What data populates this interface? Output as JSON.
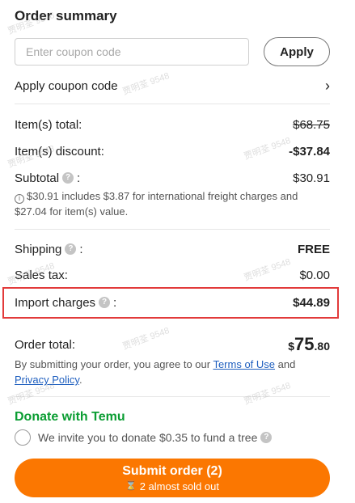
{
  "title": "Order summary",
  "coupon": {
    "placeholder": "Enter coupon code",
    "value": "",
    "apply_label": "Apply",
    "row_label": "Apply coupon code"
  },
  "summary": {
    "items_total_label": "Item(s) total:",
    "items_total_value": "$68.75",
    "items_discount_label": "Item(s) discount:",
    "items_discount_value": "-$37.84",
    "subtotal_label": "Subtotal",
    "subtotal_value": "$30.91",
    "subtotal_note": "$30.91 includes $3.87 for international freight charges and $27.04 for item(s) value.",
    "shipping_label": "Shipping",
    "shipping_value": "FREE",
    "sales_tax_label": "Sales tax:",
    "sales_tax_value": "$0.00",
    "import_label": "Import charges",
    "import_value": "$44.89"
  },
  "total": {
    "label": "Order total:",
    "currency": "$",
    "dollars": "75",
    "cents": ".80"
  },
  "terms": {
    "prefix": "By submitting your order, you agree to our ",
    "terms_link": "Terms of Use",
    "middle": " and ",
    "privacy_link": "Privacy Policy",
    "suffix": "."
  },
  "donate": {
    "title": "Donate with Temu",
    "text": "We invite you to donate $0.35 to fund a tree"
  },
  "submit": {
    "label": "Submit order (2)",
    "sub": "2 almost sold out"
  },
  "watermark": "贾明荃 9548",
  "colors": {
    "accent": "#fb7701",
    "discount": "#f5871f",
    "green": "#0a9d32",
    "link": "#1f5fbf",
    "highlight_border": "#e23a3a"
  },
  "icons": [
    "chevron-right-icon",
    "question-icon",
    "info-icon",
    "hourglass-icon"
  ]
}
